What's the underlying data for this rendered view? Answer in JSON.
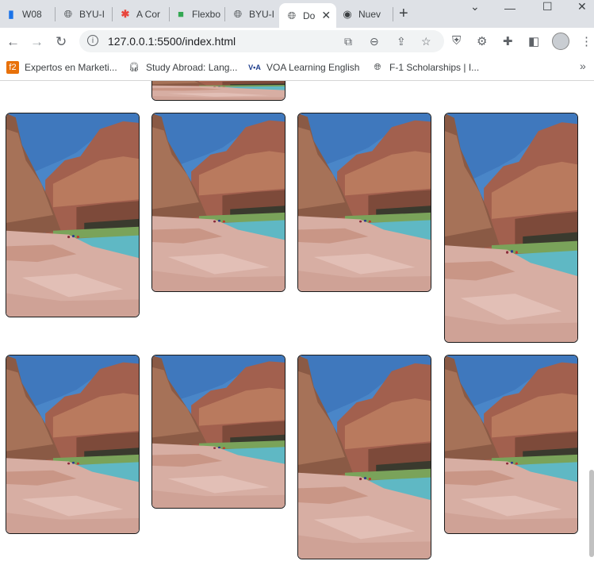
{
  "tabs": [
    {
      "label": "W08",
      "icon": "bar-chart-icon"
    },
    {
      "label": "BYU-I",
      "icon": "globe-icon"
    },
    {
      "label": "A Cor",
      "icon": "asterisk-icon"
    },
    {
      "label": "Flexbo",
      "icon": "frog-icon"
    },
    {
      "label": "BYU-I",
      "icon": "globe-icon"
    },
    {
      "label": "Do",
      "icon": "globe-icon",
      "active": true
    },
    {
      "label": "Nuev",
      "icon": "chrome-icon"
    }
  ],
  "address": {
    "url": "127.0.0.1:5500/index.html"
  },
  "bookmarks": [
    {
      "label": "Expertos en Marketi...",
      "icon": "f2-icon"
    },
    {
      "label": "Study Abroad: Lang...",
      "icon": "headset-icon"
    },
    {
      "label": "VOA Learning English",
      "icon": "voa-icon"
    },
    {
      "label": "F-1 Scholarships | I...",
      "icon": "globe-icon"
    }
  ],
  "gallery": {
    "image_alt": "Grand Canyon river canyon photo",
    "colors": {
      "sky": "#4a86c8",
      "cliff": "#a2604e",
      "rock": "#d7aea3",
      "water": "#5fb8c4",
      "border": "#1a1a1a"
    }
  }
}
